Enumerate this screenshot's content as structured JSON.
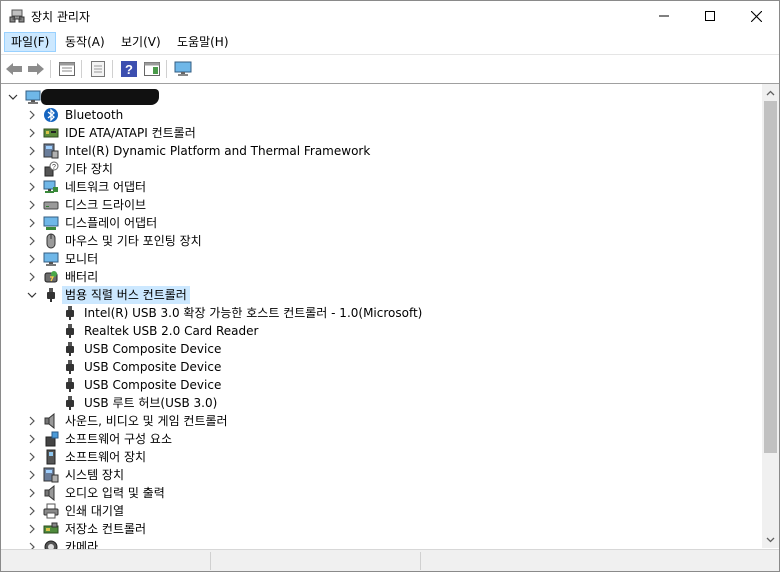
{
  "window": {
    "title": "장치 관리자"
  },
  "menu": {
    "items": [
      {
        "label": "파일(F)"
      },
      {
        "label": "동작(A)"
      },
      {
        "label": "보기(V)"
      },
      {
        "label": "도움말(H)"
      }
    ]
  },
  "toolbar": {
    "buttons": [
      "back-arrow-icon",
      "forward-arrow-icon",
      "properties-view-icon",
      "show-hidden-icon",
      "help-icon",
      "action-pane-icon",
      "monitor-scan-icon"
    ]
  },
  "tree": {
    "root_label": "",
    "categories": [
      {
        "label": "Bluetooth",
        "icon": "bluetooth-icon",
        "expanded": false
      },
      {
        "label": "IDE ATA/ATAPI 컨트롤러",
        "icon": "ide-controller-icon",
        "expanded": false
      },
      {
        "label": "Intel(R) Dynamic Platform and Thermal Framework",
        "icon": "system-device-icon",
        "expanded": false
      },
      {
        "label": "기타 장치",
        "icon": "unknown-device-icon",
        "expanded": false
      },
      {
        "label": "네트워크 어댑터",
        "icon": "network-adapter-icon",
        "expanded": false
      },
      {
        "label": "디스크 드라이브",
        "icon": "disk-drive-icon",
        "expanded": false
      },
      {
        "label": "디스플레이 어댑터",
        "icon": "display-adapter-icon",
        "expanded": false
      },
      {
        "label": "마우스 및 기타 포인팅 장치",
        "icon": "mouse-icon",
        "expanded": false
      },
      {
        "label": "모니터",
        "icon": "monitor-icon",
        "expanded": false
      },
      {
        "label": "배터리",
        "icon": "battery-icon",
        "expanded": false
      },
      {
        "label": "범용 직렬 버스 컨트롤러",
        "icon": "usb-icon",
        "expanded": true,
        "selected": true
      },
      {
        "label": "사운드, 비디오 및 게임 컨트롤러",
        "icon": "speaker-icon",
        "expanded": false
      },
      {
        "label": "소프트웨어 구성 요소",
        "icon": "software-component-icon",
        "expanded": false
      },
      {
        "label": "소프트웨어 장치",
        "icon": "software-device-icon",
        "expanded": false
      },
      {
        "label": "시스템 장치",
        "icon": "system-device-icon",
        "expanded": false
      },
      {
        "label": "오디오 입력 및 출력",
        "icon": "speaker-icon",
        "expanded": false
      },
      {
        "label": "인쇄 대기열",
        "icon": "printer-icon",
        "expanded": false
      },
      {
        "label": "저장소 컨트롤러",
        "icon": "storage-controller-icon",
        "expanded": false
      },
      {
        "label": "카메라",
        "icon": "camera-icon",
        "expanded": false
      }
    ],
    "usb_children": [
      {
        "label": "Intel(R) USB 3.0 확장 가능한 호스트 컨트롤러 - 1.0(Microsoft)"
      },
      {
        "label": "Realtek USB 2.0 Card Reader"
      },
      {
        "label": "USB Composite Device"
      },
      {
        "label": "USB Composite Device"
      },
      {
        "label": "USB Composite Device"
      },
      {
        "label": "USB 루트 허브(USB 3.0)"
      }
    ]
  },
  "colors": {
    "selection": "#cce8ff",
    "window_border": "#8a8a8a"
  }
}
